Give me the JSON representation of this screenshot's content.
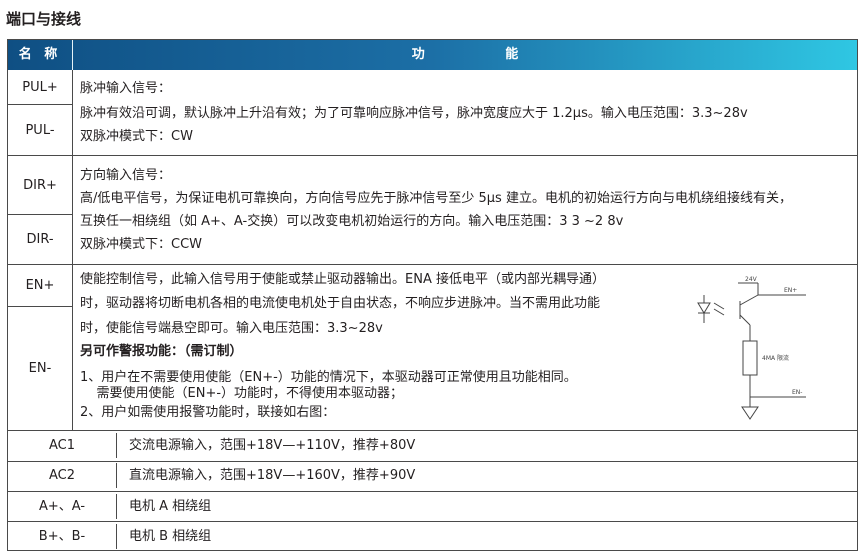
{
  "heading": "端口与接线",
  "header": {
    "name": "名 称",
    "function": "功 能"
  },
  "pul": {
    "names": [
      "PUL+",
      "PUL-"
    ],
    "lines": [
      "脉冲输入信号：",
      "脉冲有效沿可调，默认脉冲上升沿有效；为了可靠响应脉冲信号，脉冲宽度应大于 1.2μs。输入电压范围：3.3~28v",
      "双脉冲模式下：CW"
    ]
  },
  "dir": {
    "names": [
      "DIR+",
      "DIR-"
    ],
    "lines": [
      "方向输入信号：",
      "高/低电平信号，为保证电机可靠换向，方向信号应先于脉冲信号至少 5μs 建立。电机的初始运行方向与电机绕组接线有关，",
      "互换任一相绕组（如 A+、A-交换）可以改变电机初始运行的方向。输入电压范围：3 3 ~2 8v",
      "双脉冲模式下：CCW"
    ]
  },
  "en": {
    "names": [
      "EN+",
      "EN-"
    ],
    "lines": [
      "使能控制信号，此输入信号用于使能或禁止驱动器输出。ENA 接低电平（或内部光耦导通）",
      "时，驱动器将切断电机各相的电流使电机处于自由状态，不响应步进脉冲。当不需用此功能",
      "时，使能信号端悬空即可。输入电压范围：3.3~28v",
      "另可作警报功能：（需订制）",
      "1、用户在不需要使用使能（EN+-）功能的情况下，本驱动器可正常使用且功能相同。",
      "    需要使用使能（EN+-）功能时，不得使用本驱动器；",
      "2、用户如需使用报警功能时，联接如右图："
    ],
    "diagram": {
      "vcc": "24V",
      "en_plus": "EN+",
      "resistor": "4MA 限流",
      "en_minus": "EN-"
    }
  },
  "rows": [
    {
      "name": "AC1",
      "function": "交流电源输入，范围+18V—+110V，推荐+80V"
    },
    {
      "name": "AC2",
      "function": "直流电源输入，范围+18V—+160V，推荐+90V"
    },
    {
      "name": "A+、A-",
      "function": "电机 A 相绕组"
    },
    {
      "name": "B+、B-",
      "function": "电机 B 相绕组"
    }
  ]
}
